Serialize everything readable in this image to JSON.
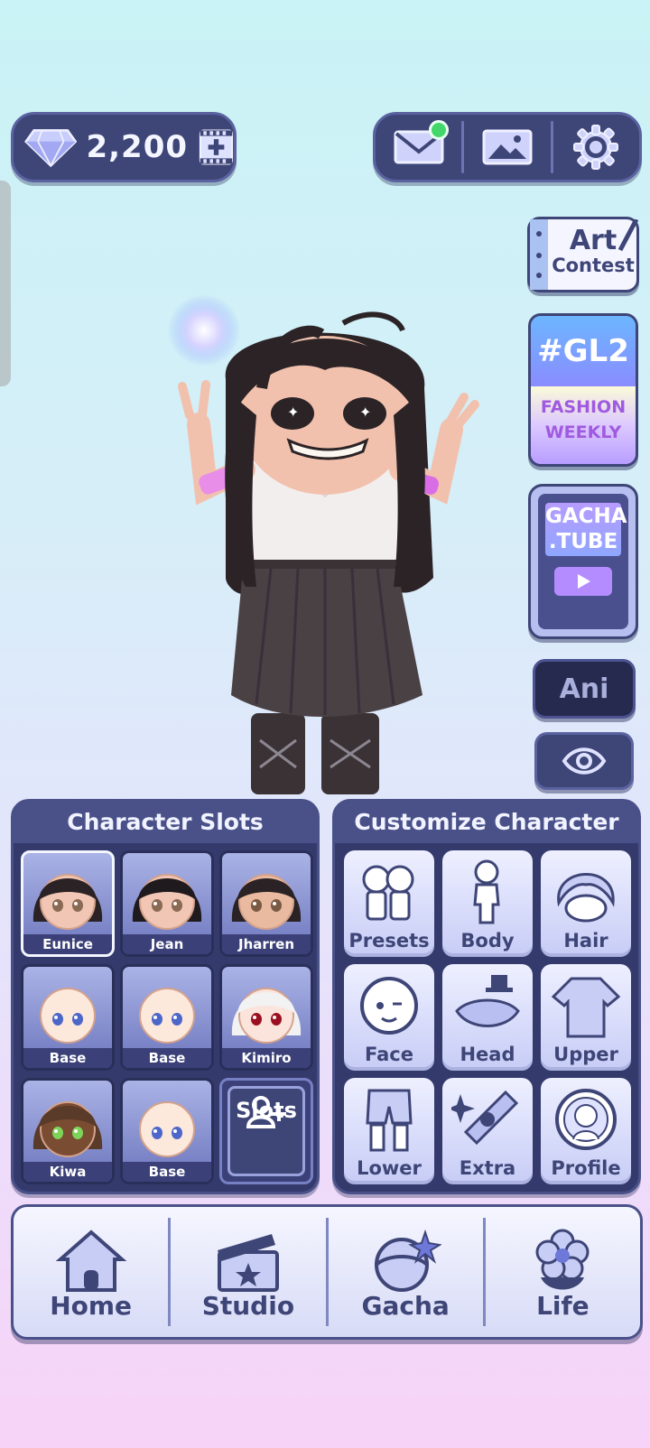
{
  "currency": {
    "gems": "2,200"
  },
  "side": {
    "art_contest": [
      "Art",
      "Contest"
    ],
    "gl2": {
      "tag": "#GL2",
      "line1": "FASHION",
      "line2": "WEEKLY"
    },
    "gacha_tube": [
      "GACHA",
      ".TUBE"
    ],
    "ani_label": "Ani"
  },
  "slots": {
    "title": "Character Slots",
    "items": [
      {
        "name": "Eunice",
        "hair": "#2a2224",
        "skin": "#f1c6b4",
        "eyes": "#8a6a55"
      },
      {
        "name": "Jean",
        "hair": "#1f1a1d",
        "skin": "#f1c6b4",
        "eyes": "#8a6a55"
      },
      {
        "name": "Jharren",
        "hair": "#2a2224",
        "skin": "#e9b9a0",
        "eyes": "#7b5a44"
      },
      {
        "name": "Base",
        "hair": "none",
        "skin": "#fde8dc",
        "eyes": "#4d66c9"
      },
      {
        "name": "Base",
        "hair": "none",
        "skin": "#fde8dc",
        "eyes": "#4d66c9"
      },
      {
        "name": "Kimiro",
        "hair": "#f2f2f2",
        "skin": "#fbe4dc",
        "eyes": "#9a1020"
      },
      {
        "name": "Kiwa",
        "hair": "#5a3a28",
        "skin": "#7a4c32",
        "eyes": "#7ed35a"
      },
      {
        "name": "Base",
        "hair": "none",
        "skin": "#fde8dc",
        "eyes": "#4d66c9"
      }
    ],
    "add_label": "Slots"
  },
  "customize": {
    "title": "Customize Character",
    "items": [
      {
        "label": "Presets",
        "icon": "presets-icon"
      },
      {
        "label": "Body",
        "icon": "body-icon"
      },
      {
        "label": "Hair",
        "icon": "hair-icon"
      },
      {
        "label": "Face",
        "icon": "face-icon"
      },
      {
        "label": "Head",
        "icon": "head-icon"
      },
      {
        "label": "Upper",
        "icon": "upper-icon"
      },
      {
        "label": "Lower",
        "icon": "lower-icon"
      },
      {
        "label": "Extra",
        "icon": "extra-icon"
      },
      {
        "label": "Profile",
        "icon": "profile-icon"
      }
    ]
  },
  "nav": [
    {
      "label": "Home",
      "icon": "house-icon"
    },
    {
      "label": "Studio",
      "icon": "clapperboard-icon"
    },
    {
      "label": "Gacha",
      "icon": "gacha-icon"
    },
    {
      "label": "Life",
      "icon": "flower-icon"
    }
  ],
  "colors": {
    "panel": "#343a6b",
    "accent": "#4a5189",
    "notification": "#43d66a"
  }
}
